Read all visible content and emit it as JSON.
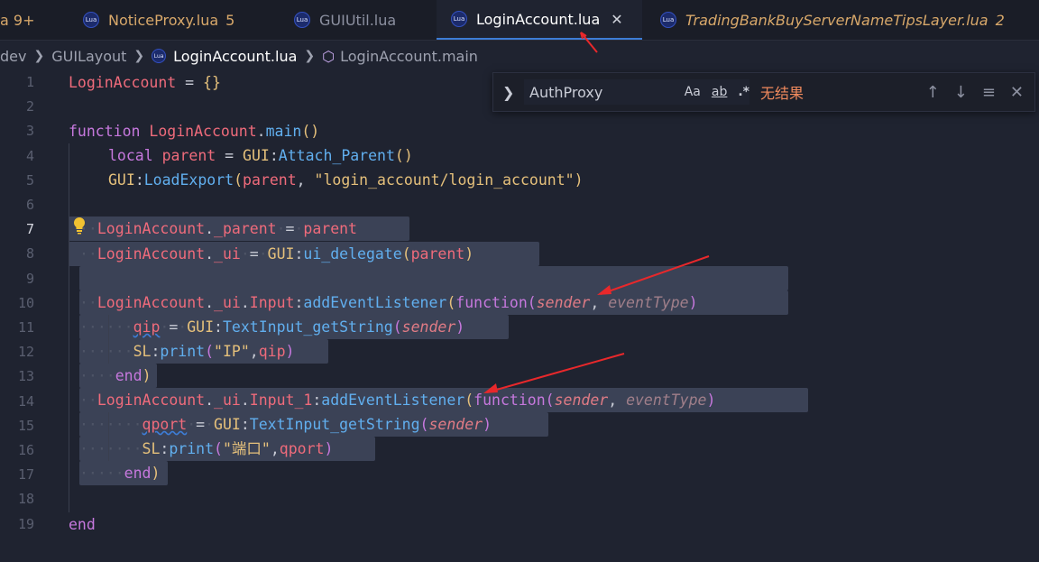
{
  "tabs": [
    {
      "name": "a 9+",
      "badge": ""
    },
    {
      "name": "NoticeProxy.lua",
      "badge": "5"
    },
    {
      "name": "GUIUtil.lua",
      "badge": ""
    },
    {
      "name": "LoginAccount.lua",
      "badge": "",
      "close": "✕"
    },
    {
      "name": "TradingBankBuyServerNameTipsLayer.lua",
      "badge": "2"
    }
  ],
  "lua_icon_text": "Lua",
  "breadcrumb": {
    "parts": [
      "dev",
      "GUILayout",
      "LoginAccount.lua",
      "LoginAccount.main"
    ]
  },
  "find": {
    "value": "AuthProxy",
    "match_case": "Aa",
    "whole_word": "ab",
    "regex": ".*",
    "no_results": "无结果"
  },
  "line_numbers": [
    "1",
    "2",
    "3",
    "4",
    "5",
    "6",
    "7",
    "8",
    "9",
    "10",
    "11",
    "12",
    "13",
    "14",
    "15",
    "16",
    "17",
    "18",
    "19"
  ],
  "current_line": "7",
  "colors": {
    "accent": "#3d7dd6",
    "selection": "#3b4256",
    "arrow": "#e8282b"
  }
}
